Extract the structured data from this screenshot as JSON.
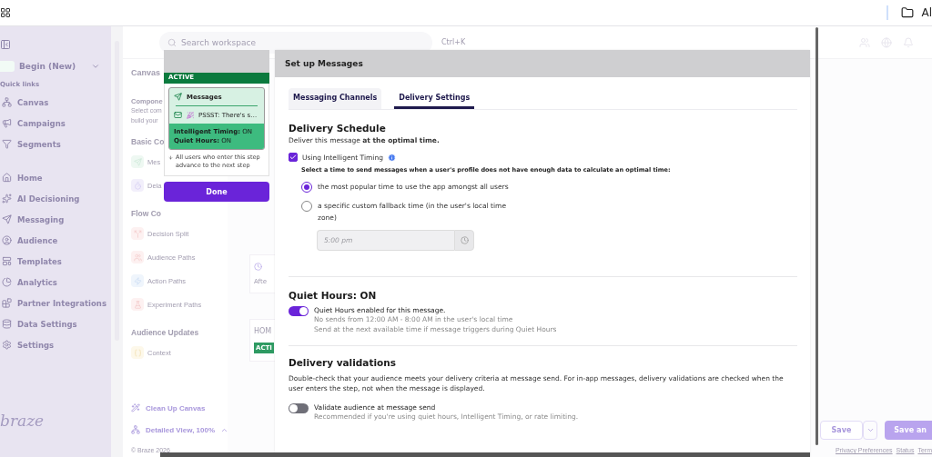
{
  "top_bar": {
    "folder_label": "Al"
  },
  "sidebar": {
    "workspace": "Begin (New)",
    "section_label": "Quick links",
    "quick_links": [
      {
        "label": "Canvas",
        "kind": "canvas"
      },
      {
        "label": "Campaigns",
        "kind": "campaigns"
      },
      {
        "label": "Segments",
        "kind": "segments"
      }
    ],
    "items": [
      {
        "label": "Home",
        "kind": "home"
      },
      {
        "label": "AI Decisioning",
        "kind": "ai"
      },
      {
        "label": "Messaging",
        "kind": "messaging"
      },
      {
        "label": "Audience",
        "kind": "audience"
      },
      {
        "label": "Templates",
        "kind": "templates"
      },
      {
        "label": "Analytics",
        "kind": "analytics"
      },
      {
        "label": "Partner Integrations",
        "kind": "partners"
      },
      {
        "label": "Data Settings",
        "kind": "data"
      },
      {
        "label": "Settings",
        "kind": "settings"
      }
    ],
    "logo": "braze"
  },
  "header": {
    "search": {
      "placeholder": "Search workspace"
    },
    "shortcut": "Ctrl+K"
  },
  "components_panel": {
    "tab": "Canvas",
    "title": "Compone",
    "description_lines": [
      "Select com",
      "build your"
    ],
    "sections": [
      {
        "heading": "Basic Co",
        "items": [
          {
            "label": "Mes",
            "kind": "message"
          },
          {
            "label": "Dela",
            "kind": "delay"
          }
        ]
      },
      {
        "heading": "Flow Co",
        "items": [
          {
            "label": "Decision Split",
            "kind": "split"
          },
          {
            "label": "Audience Paths",
            "kind": "paths"
          },
          {
            "label": "Action Paths",
            "kind": "action"
          },
          {
            "label": "Experiment Paths",
            "kind": "experiment"
          }
        ]
      },
      {
        "heading": "Audience Updates",
        "items": [
          {
            "label": "Context",
            "kind": "context"
          }
        ]
      }
    ],
    "cleanup": "Clean Up Canvas",
    "view": "Detailed View, 100%",
    "copyright": "© Braze 2026"
  },
  "canvas": {
    "delay_node": "Afte",
    "home_node": {
      "title": "HOM",
      "status": "ACTI"
    },
    "save_button": "Save",
    "save_and_button": "Save an",
    "footer_links": [
      "Privacy Preferences",
      "Status",
      "Term"
    ]
  },
  "node_card": {
    "status": "ACTIVE",
    "step_type": "Messages",
    "message": "PSSST: There's s…",
    "settings": [
      {
        "label": "Intelligent Timing:",
        "value": "ON"
      },
      {
        "label": "Quiet Hours:",
        "value": "ON"
      }
    ],
    "advance_note": "All users who enter this step advance to the next step",
    "done_button": "Done"
  },
  "modal": {
    "title": "Set up Messages",
    "tabs": [
      {
        "label": "Messaging Channels",
        "selected": false
      },
      {
        "label": "Delivery Settings",
        "selected": true
      }
    ],
    "schedule": {
      "heading": "Delivery Schedule",
      "description": "Deliver this message **at the optimal time.**",
      "intelligent_timing": {
        "label": "Using Intelligent Timing",
        "checked": true
      },
      "fallback_prompt": "Select a time to send messages when a user's profile does not have enough data to calculate an optimal time:",
      "options": [
        {
          "label": "the most popular time to use the app amongst all users",
          "selected": true
        },
        {
          "label": "a specific custom fallback time (in the user's local time zone)",
          "selected": false
        }
      ],
      "time_field": {
        "placeholder": "5:00 pm",
        "disabled": true
      }
    },
    "quiet_hours": {
      "heading": "Quiet Hours: ON",
      "toggle": {
        "on": true,
        "label": "Quiet Hours enabled for this message.",
        "details": [
          "No sends from 12:00 AM - 8:00 AM in the user's local time",
          "Send at the next available time if message triggers during Quiet Hours"
        ]
      }
    },
    "validations": {
      "heading": "Delivery validations",
      "description": "Double-check that your audience meets your delivery criteria at message send. For in-app messages, delivery validations are checked when the user enters the step, not when the message is displayed.",
      "toggle": {
        "on": false,
        "label": "Validate audience at message send",
        "details": [
          "Recommended if you're using quiet hours, Intelligent Timing, or rate limiting."
        ]
      }
    }
  }
}
